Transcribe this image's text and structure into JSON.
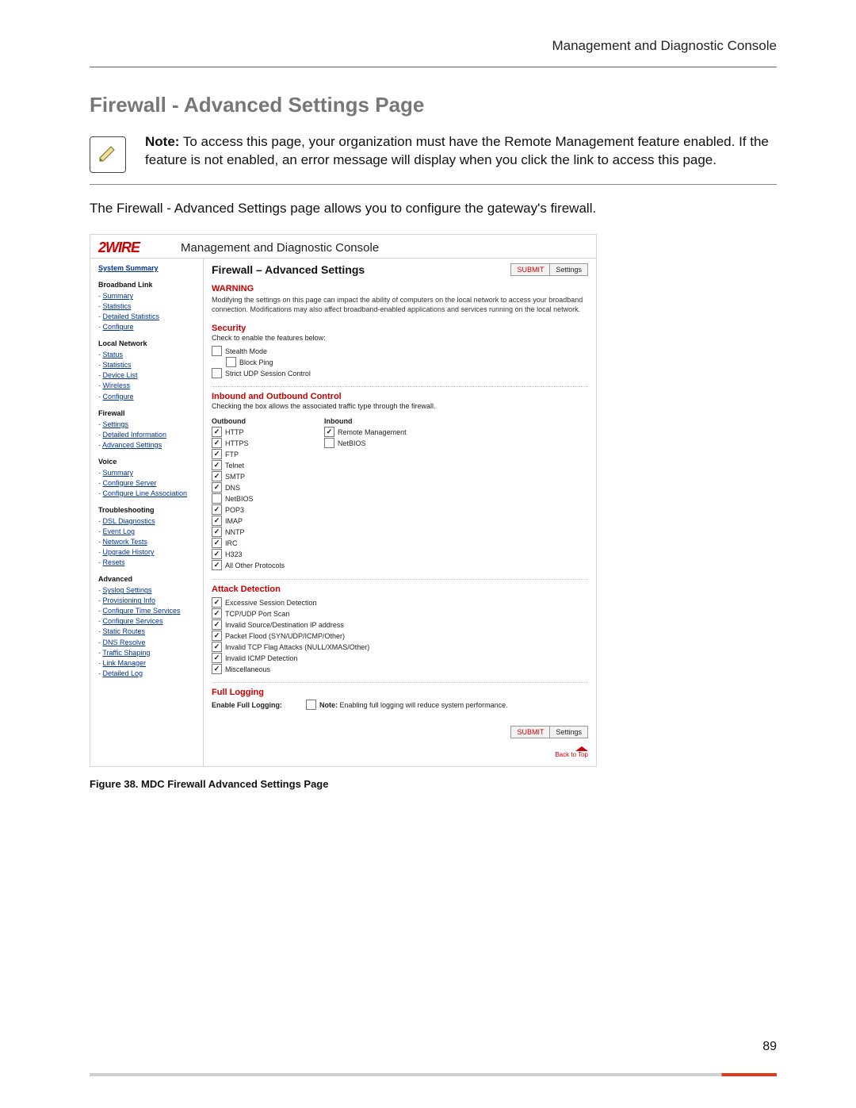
{
  "doc": {
    "running_head": "Management and Diagnostic Console",
    "h1": "Firewall - Advanced Settings Page",
    "note_label": "Note:",
    "note_body": "To access this page, your organization must have the Remote Management feature enabled. If the feature is not enabled, an error message will display when you click the link to access this page.",
    "intro": "The Firewall - Advanced Settings page allows you to configure the gateway's firewall.",
    "figure_caption": "Figure 38. MDC Firewall Advanced Settings Page",
    "page_number": "89"
  },
  "brand": {
    "logo_text": "2WIRE",
    "console_title": "Management and Diagnostic Console"
  },
  "nav": {
    "system_summary": "System Summary",
    "groups": [
      {
        "head": "Broadband Link",
        "items": [
          "Summary",
          "Statistics",
          "Detailed Statistics",
          "Configure"
        ]
      },
      {
        "head": "Local Network",
        "items": [
          "Status",
          "Statistics",
          "Device List",
          "Wireless",
          "Configure"
        ]
      },
      {
        "head": "Firewall",
        "items": [
          "Settings",
          "Detailed Information",
          "Advanced Settings"
        ]
      },
      {
        "head": "Voice",
        "items": [
          "Summary",
          "Configure Server",
          "Configure Line Association"
        ]
      },
      {
        "head": "Troubleshooting",
        "items": [
          "DSL Diagnostics",
          "Event Log",
          "Network Tests",
          "Upgrade History",
          "Resets"
        ]
      },
      {
        "head": "Advanced",
        "items": [
          "Syslog Settings",
          "Provisioning Info",
          "Configure Time Services",
          "Configure Services",
          "Static Routes",
          "DNS Resolve",
          "Traffic Shaping",
          "Link Manager",
          "Detailed Log"
        ]
      }
    ]
  },
  "main": {
    "page_title": "Firewall – Advanced Settings",
    "submit_label": "SUBMIT",
    "settings_label": "Settings",
    "warning_head": "WARNING",
    "warning_text": "Modifying the settings on this page can impact the ability of computers on the local network to access your broadband connection. Modifications may also affect broadband-enabled applications and services running on the local network.",
    "security_head": "Security",
    "security_desc": "Check to enable the features below:",
    "inout_head": "Inbound and Outbound Control",
    "inout_desc": "Checking the box allows the associated traffic type through the firewall.",
    "outbound_head": "Outbound",
    "inbound_head": "Inbound",
    "attack_head": "Attack Detection",
    "full_log_head": "Full Logging",
    "full_log_label": "Enable Full Logging:",
    "full_log_note_label": "Note:",
    "full_log_note_text": "Enabling full logging will reduce system performance.",
    "back_to_top": "Back to Top"
  },
  "security_items": [
    {
      "label": "Stealth Mode",
      "checked": false,
      "indent": false
    },
    {
      "label": "Block Ping",
      "checked": false,
      "indent": true
    },
    {
      "label": "Strict UDP Session Control",
      "checked": false,
      "indent": false
    }
  ],
  "outbound_items": [
    {
      "label": "HTTP",
      "checked": true
    },
    {
      "label": "HTTPS",
      "checked": true
    },
    {
      "label": "FTP",
      "checked": true
    },
    {
      "label": "Telnet",
      "checked": true
    },
    {
      "label": "SMTP",
      "checked": true
    },
    {
      "label": "DNS",
      "checked": true
    },
    {
      "label": "NetBIOS",
      "checked": false
    },
    {
      "label": "POP3",
      "checked": true
    },
    {
      "label": "IMAP",
      "checked": true
    },
    {
      "label": "NNTP",
      "checked": true
    },
    {
      "label": "IRC",
      "checked": true
    },
    {
      "label": "H323",
      "checked": true
    },
    {
      "label": "All Other Protocols",
      "checked": true
    }
  ],
  "inbound_items": [
    {
      "label": "Remote Management",
      "checked": true
    },
    {
      "label": "NetBIOS",
      "checked": false
    }
  ],
  "attack_items": [
    {
      "label": "Excessive Session Detection",
      "checked": true
    },
    {
      "label": "TCP/UDP Port Scan",
      "checked": true
    },
    {
      "label": "Invalid Source/Destination IP address",
      "checked": true
    },
    {
      "label": "Packet Flood (SYN/UDP/ICMP/Other)",
      "checked": true
    },
    {
      "label": "Invalid TCP Flag Attacks (NULL/XMAS/Other)",
      "checked": true
    },
    {
      "label": "Invalid ICMP Detection",
      "checked": true
    },
    {
      "label": "Miscellaneous",
      "checked": true
    }
  ],
  "full_log_checked": false
}
